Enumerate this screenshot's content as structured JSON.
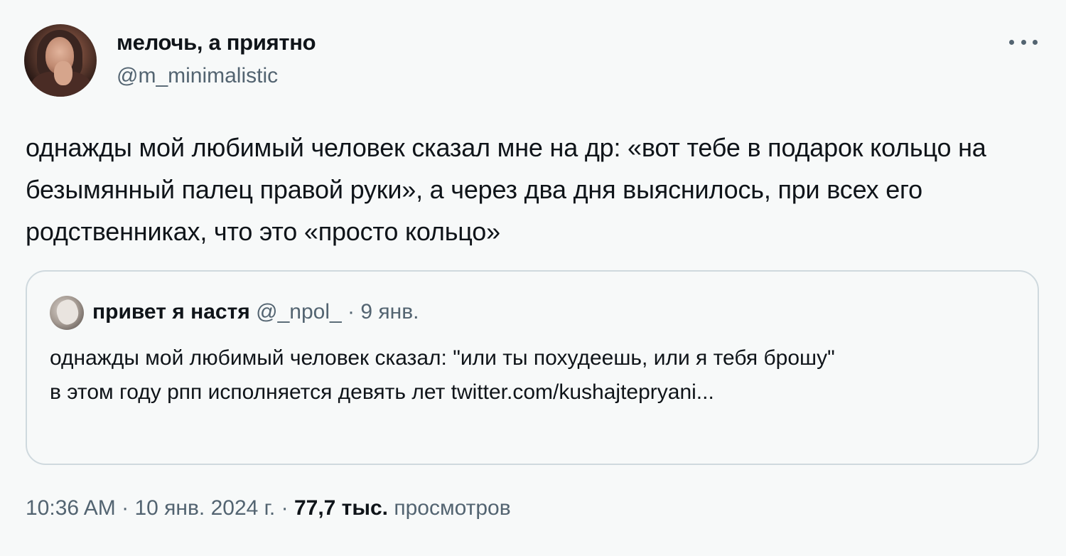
{
  "author": {
    "display_name": "мелочь, а приятно",
    "handle": "@m_minimalistic"
  },
  "tweet": {
    "text": "однажды мой любимый человек сказал мне на др: «вот тебе в подарок кольцо на безымянный палец правой руки», а через два дня выяснилось, при всех его родственниках, что это «просто кольцо»"
  },
  "quoted_tweet": {
    "display_name": "привет я настя",
    "handle": "@_npol_",
    "separator": "·",
    "date": "9 янв.",
    "text": "однажды мой любимый человек сказал: \"или ты похудеешь, или я тебя брошу\"\nв этом году рпп исполняется девять лет twitter.com/kushajtepryani..."
  },
  "meta": {
    "time": "10:36 AM",
    "separator": "·",
    "date": "10 янв. 2024 г.",
    "views_count": "77,7 тыс.",
    "views_label": "просмотров"
  },
  "icons": {
    "more": "more-horizontal-icon"
  },
  "colors": {
    "text_primary": "#0f1419",
    "text_secondary": "#536471",
    "border": "#cfd9de",
    "background": "#f7f9f9"
  }
}
